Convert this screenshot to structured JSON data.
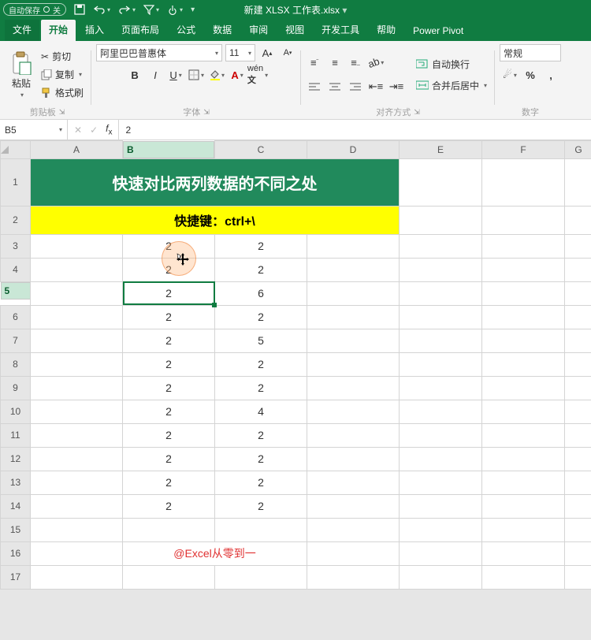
{
  "title_bar": {
    "autosave_label": "自动保存",
    "autosave_state": "关",
    "document_title": "新建 XLSX 工作表.xlsx"
  },
  "tabs": {
    "file": "文件",
    "home": "开始",
    "insert": "插入",
    "layout": "页面布局",
    "formulas": "公式",
    "data": "数据",
    "review": "审阅",
    "view": "视图",
    "dev": "开发工具",
    "help": "帮助",
    "pp": "Power Pivot"
  },
  "ribbon": {
    "clipboard": {
      "paste": "粘贴",
      "cut": "剪切",
      "copy": "复制",
      "painter": "格式刷",
      "group": "剪贴板"
    },
    "font": {
      "fontname": "阿里巴巴普惠体",
      "fontsize": "11",
      "group": "字体"
    },
    "align": {
      "wrap": "自动换行",
      "merge": "合并后居中",
      "group": "对齐方式"
    },
    "number": {
      "format": "常规",
      "group": "数字"
    }
  },
  "namebox": "B5",
  "fx_value": "2",
  "columns": [
    "A",
    "B",
    "C",
    "D",
    "E",
    "F",
    "G"
  ],
  "rows": [
    "1",
    "2",
    "3",
    "4",
    "5",
    "6",
    "7",
    "8",
    "9",
    "10",
    "11",
    "12",
    "13",
    "14",
    "15",
    "16",
    "17"
  ],
  "cells": {
    "title": "快速对比两列数据的不同之处",
    "subtitle": "快捷键：ctrl+\\",
    "B3": "2",
    "C3": "2",
    "B4": "2",
    "C4": "2",
    "B5": "2",
    "C5": "6",
    "B6": "2",
    "C6": "2",
    "B7": "2",
    "C7": "5",
    "B8": "2",
    "C8": "2",
    "B9": "2",
    "C9": "2",
    "B10": "2",
    "C10": "4",
    "B11": "2",
    "C11": "2",
    "B12": "2",
    "C12": "2",
    "B13": "2",
    "C13": "2",
    "B14": "2",
    "C14": "2",
    "credit": "@Excel从零到一"
  }
}
